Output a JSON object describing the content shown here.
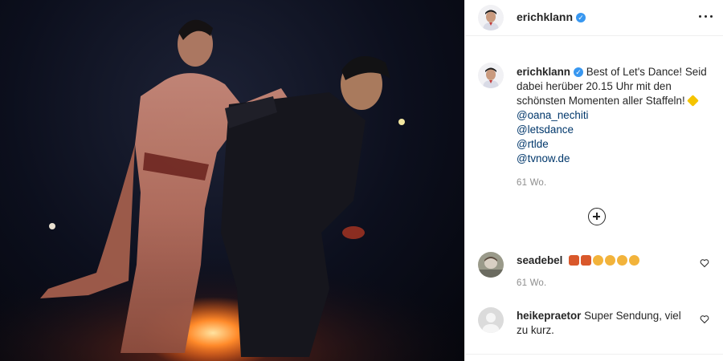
{
  "post": {
    "username": "erichklann",
    "caption_text": "Best of Let's Dance! Seid dabei herüber 20.15 Uhr mit den schönsten Momenten aller Staffeln!",
    "mentions": [
      "@oana_nechiti",
      "@letsdance",
      "@rtlde",
      "@tvnow.de"
    ],
    "time": "61 Wo."
  },
  "comments": [
    {
      "username": "seadebel",
      "text": "",
      "time": "61 Wo."
    },
    {
      "username": "heikepraetor",
      "text": "Super Sendung, viel zu kurz.",
      "time": ""
    }
  ],
  "icons": {
    "verified": "verified-badge-icon",
    "more": "more-options-icon",
    "load_more": "plus-circle-icon",
    "like": "heart-icon"
  },
  "colors": {
    "link": "#00376b",
    "verified": "#3897f0",
    "muted": "#8e8e8e"
  }
}
